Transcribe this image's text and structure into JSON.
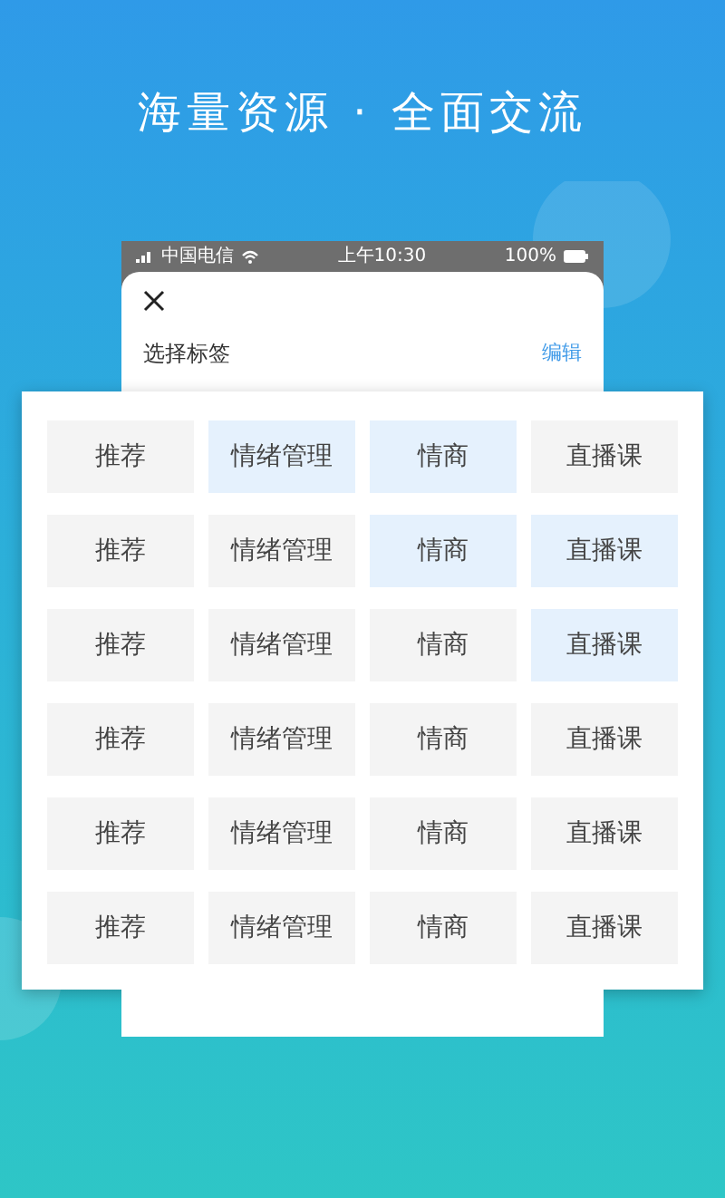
{
  "headline": "海量资源 · 全面交流",
  "status_bar": {
    "carrier": "中国电信",
    "time": "上午10:30",
    "battery": "100%"
  },
  "sheet": {
    "title": "选择标签",
    "edit": "编辑"
  },
  "tag_rows": [
    {
      "tags": [
        {
          "label": "推荐",
          "selected": false
        },
        {
          "label": "情绪管理",
          "selected": true
        },
        {
          "label": "情商",
          "selected": true
        },
        {
          "label": "直播课",
          "selected": false
        }
      ]
    },
    {
      "tags": [
        {
          "label": "推荐",
          "selected": false
        },
        {
          "label": "情绪管理",
          "selected": false
        },
        {
          "label": "情商",
          "selected": true
        },
        {
          "label": "直播课",
          "selected": true
        }
      ]
    },
    {
      "tags": [
        {
          "label": "推荐",
          "selected": false
        },
        {
          "label": "情绪管理",
          "selected": false
        },
        {
          "label": "情商",
          "selected": false
        },
        {
          "label": "直播课",
          "selected": true
        }
      ]
    },
    {
      "tags": [
        {
          "label": "推荐",
          "selected": false
        },
        {
          "label": "情绪管理",
          "selected": false
        },
        {
          "label": "情商",
          "selected": false
        },
        {
          "label": "直播课",
          "selected": false
        }
      ]
    },
    {
      "tags": [
        {
          "label": "推荐",
          "selected": false
        },
        {
          "label": "情绪管理",
          "selected": false
        },
        {
          "label": "情商",
          "selected": false
        },
        {
          "label": "直播课",
          "selected": false
        }
      ]
    },
    {
      "tags": [
        {
          "label": "推荐",
          "selected": false
        },
        {
          "label": "情绪管理",
          "selected": false
        },
        {
          "label": "情商",
          "selected": false
        },
        {
          "label": "直播课",
          "selected": false
        }
      ]
    }
  ]
}
